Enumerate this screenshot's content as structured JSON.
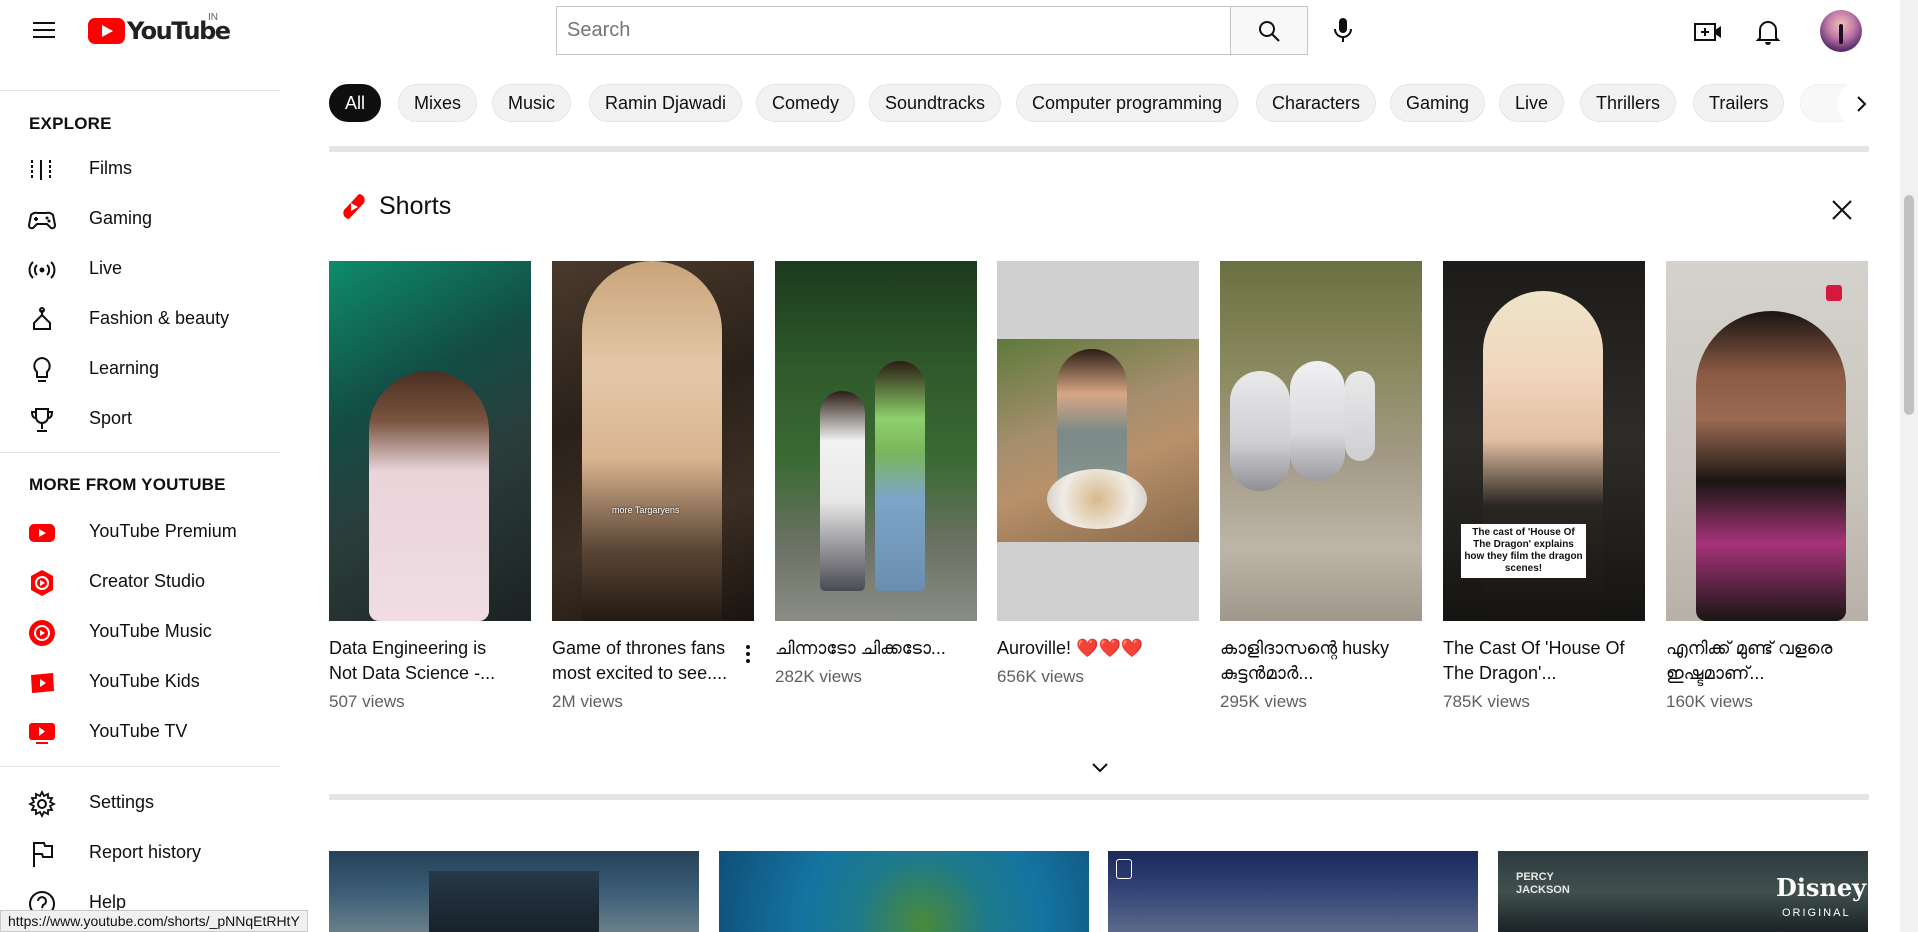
{
  "masthead": {
    "logo_text": "YouTube",
    "country": "IN",
    "search_placeholder": "Search"
  },
  "sidebar": {
    "explore_heading": "EXPLORE",
    "explore_items": [
      {
        "label": "Films",
        "icon": "film-icon"
      },
      {
        "label": "Gaming",
        "icon": "gamepad-icon"
      },
      {
        "label": "Live",
        "icon": "live-broadcast-icon"
      },
      {
        "label": "Fashion & beauty",
        "icon": "hanger-icon"
      },
      {
        "label": "Learning",
        "icon": "lightbulb-icon"
      },
      {
        "label": "Sport",
        "icon": "trophy-icon"
      }
    ],
    "more_heading": "MORE FROM YOUTUBE",
    "more_items": [
      {
        "label": "YouTube Premium",
        "icon": "youtube-premium-icon"
      },
      {
        "label": "Creator Studio",
        "icon": "creator-studio-icon"
      },
      {
        "label": "YouTube Music",
        "icon": "youtube-music-icon"
      },
      {
        "label": "YouTube Kids",
        "icon": "youtube-kids-icon"
      },
      {
        "label": "YouTube TV",
        "icon": "youtube-tv-icon"
      }
    ],
    "settings_items": [
      {
        "label": "Settings",
        "icon": "gear-icon"
      },
      {
        "label": "Report history",
        "icon": "flag-icon"
      },
      {
        "label": "Help",
        "icon": "help-icon"
      }
    ]
  },
  "chips": [
    "All",
    "Mixes",
    "Music",
    "Ramin Djawadi",
    "Comedy",
    "Soundtracks",
    "Computer programming",
    "Characters",
    "Gaming",
    "Live",
    "Thrillers",
    "Trailers"
  ],
  "shorts": {
    "title": "Shorts",
    "items": [
      {
        "title": "Data Engineering is Not Data Science -...",
        "views": "507 views",
        "thumb_text": ""
      },
      {
        "title": "Game of thrones fans most excited to see....",
        "views": "2M views",
        "thumb_text": "more Targaryens"
      },
      {
        "title": "ചിന്നാടോ ചിക്കടോ...",
        "views": "282K views",
        "thumb_text": ""
      },
      {
        "title": "Auroville! ❤️❤️❤️",
        "views": "656K views",
        "thumb_text": ""
      },
      {
        "title": "കാളിദാസന്റെ husky കുട്ടൻമാർ...",
        "views": "295K views",
        "thumb_text": ""
      },
      {
        "title": "The Cast Of 'House Of The Dragon'...",
        "views": "785K views",
        "thumb_text": "The cast of 'House Of The Dragon' explains how they film the dragon scenes!"
      },
      {
        "title": "എനിക്ക് മുണ്ട് വളരെ ഇഷ്ടമാണ്...",
        "views": "160K views",
        "thumb_text": ""
      }
    ]
  },
  "videos": [
    {
      "badge": ""
    },
    {
      "badge": ""
    },
    {
      "badge": ""
    },
    {
      "badge": "PERCY JACKSON",
      "brand": "Disney+",
      "brand_sub": "ORIGINAL"
    }
  ],
  "status_url": "https://www.youtube.com/shorts/_pNNqEtRHtY",
  "colors": {
    "brand_red": "#ff0000",
    "chip_active": "#0f0f0f",
    "chip_bg": "#f2f2f2",
    "muted": "#606060"
  }
}
